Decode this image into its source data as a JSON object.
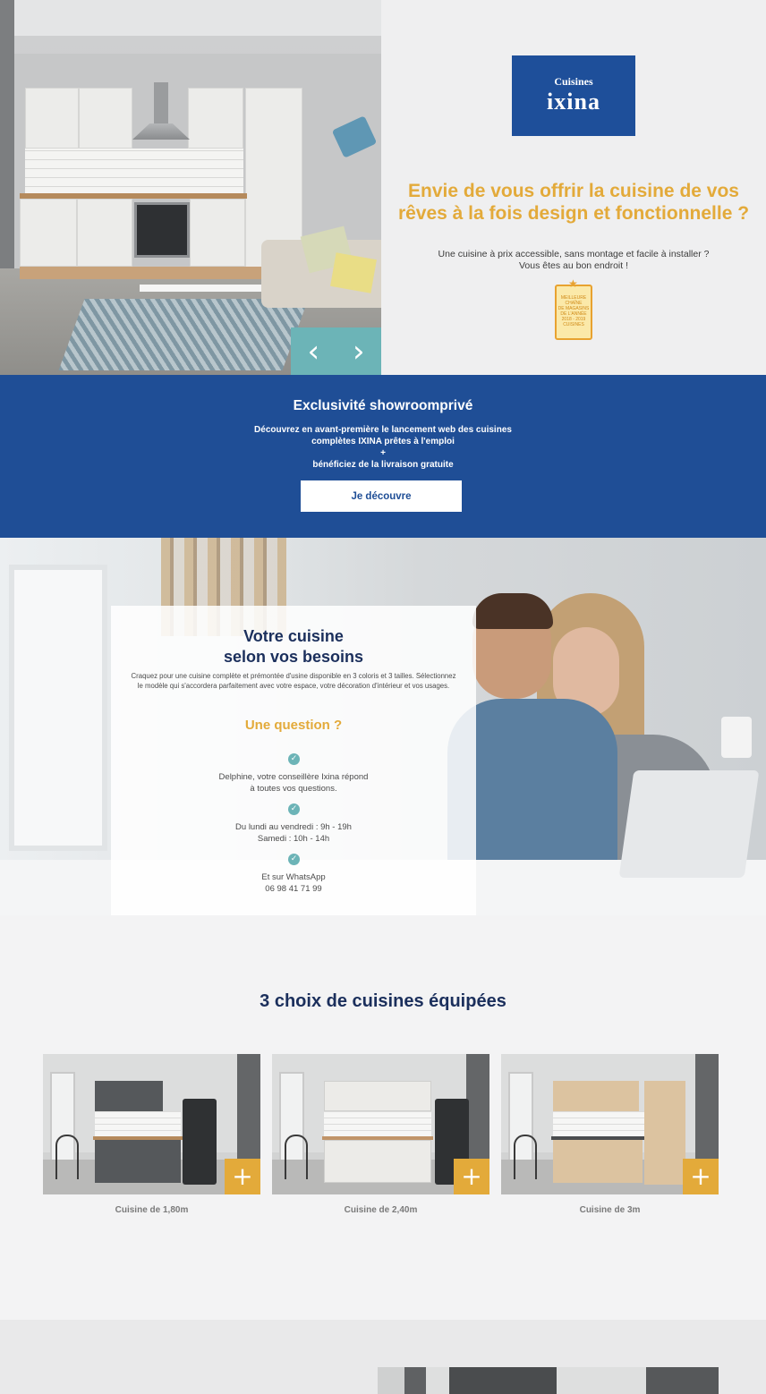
{
  "hero": {
    "logo": {
      "line1": "Cuisines",
      "line2": "ixina"
    },
    "title": "Envie de vous offrir la cuisine de vos rêves à la fois design et fonctionnelle ?",
    "subtitle_line1": "Une cuisine à prix accessible, sans montage et facile à installer ?",
    "subtitle_line2": "Vous êtes au bon endroit !",
    "award": {
      "line1": "MEILLEURE",
      "line2": "CHAÎNE",
      "line3": "DE MAGASINS",
      "line4": "DE L'ANNÉE",
      "line5": "2018 - 2019",
      "line6": "CUISINES"
    },
    "slider": {
      "prev_icon": "‹",
      "next_icon": "›"
    }
  },
  "band": {
    "title": "Exclusivité showroomprivé",
    "line1": "Découvrez en avant-première le lancement web des cuisines",
    "line2": "complètes IXINA prêtes à l'emploi",
    "line3": "+",
    "line4": "bénéficiez de la livraison gratuite",
    "cta": "Je découvre"
  },
  "panel": {
    "title_line1": "Votre cuisine",
    "title_line2": "selon vos besoins",
    "intro": "Craquez pour une cuisine complète et prémontée d'usine disponible en 3 coloris et 3 tailles. Sélectionnez le modèle qui s'accordera parfaitement avec votre espace, votre décoration d'intérieur et vos usages.",
    "question": "Une question ?",
    "items": [
      {
        "line1": "Delphine, votre conseillère Ixina répond",
        "line2": "à toutes vos questions."
      },
      {
        "line1": "Du lundi au vendredi : 9h - 19h",
        "line2": "Samedi : 10h - 14h"
      },
      {
        "line1": "Et sur WhatsApp",
        "line2": "06 98 41 71 99"
      }
    ]
  },
  "choices": {
    "title": "3 choix de cuisines équipées",
    "cards": [
      {
        "label": "Cuisine de 1,80m",
        "plus": "+"
      },
      {
        "label": "Cuisine de 2,40m",
        "plus": "+"
      },
      {
        "label": "Cuisine de 3m",
        "plus": "+"
      }
    ]
  },
  "colors": {
    "brand_blue": "#1f4e96",
    "accent_gold": "#e3aa3a",
    "teal": "#6cb4b7",
    "navy_text": "#1b2f5c"
  }
}
